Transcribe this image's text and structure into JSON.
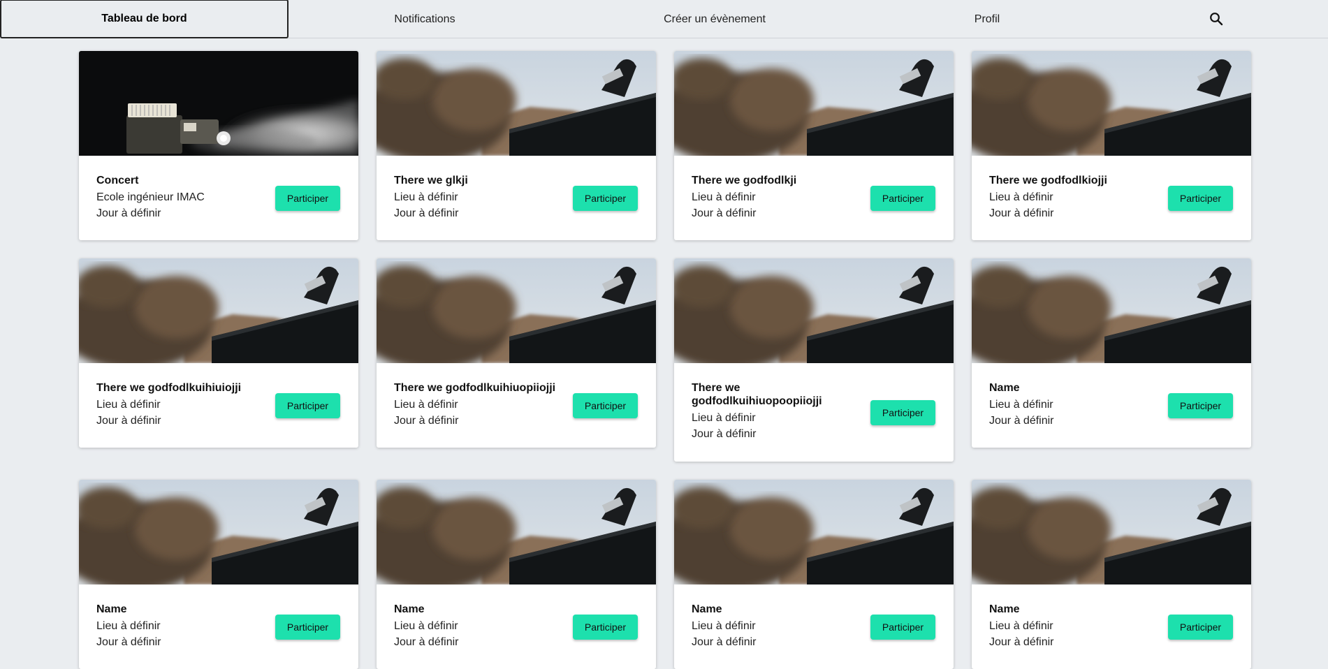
{
  "nav": {
    "items": [
      {
        "label": "Tableau de bord",
        "active": true
      },
      {
        "label": "Notifications",
        "active": false
      },
      {
        "label": "Créer un évènement",
        "active": false
      },
      {
        "label": "Profil",
        "active": false
      }
    ],
    "search_icon": "search-icon"
  },
  "colors": {
    "accent": "#1de0ad",
    "background": "#eaedf0"
  },
  "events": [
    {
      "title": "Concert",
      "place": "Ecole ingénieur IMAC",
      "day": "Jour à définir",
      "button": "Participer",
      "image": "projector-photo"
    },
    {
      "title": "There we glkji",
      "place": "Lieu à définir",
      "day": "Jour à définir",
      "button": "Participer",
      "image": "outdoor-photo"
    },
    {
      "title": "There we godfodlkji",
      "place": "Lieu à définir",
      "day": "Jour à définir",
      "button": "Participer",
      "image": "outdoor-photo"
    },
    {
      "title": "There we godfodlkiojji",
      "place": "Lieu à définir",
      "day": "Jour à définir",
      "button": "Participer",
      "image": "outdoor-photo"
    },
    {
      "title": "There we godfodlkuihiuiojji",
      "place": "Lieu à définir",
      "day": "Jour à définir",
      "button": "Participer",
      "image": "outdoor-photo"
    },
    {
      "title": "There we godfodlkuihiuopiiojji",
      "place": "Lieu à définir",
      "day": "Jour à définir",
      "button": "Participer",
      "image": "outdoor-photo"
    },
    {
      "title": "There we godfodlkuihiuopoopiiojji",
      "place": "Lieu à définir",
      "day": "Jour à définir",
      "button": "Participer",
      "image": "outdoor-photo"
    },
    {
      "title": "Name",
      "place": "Lieu à définir",
      "day": "Jour à définir",
      "button": "Participer",
      "image": "outdoor-photo"
    },
    {
      "title": "Name",
      "place": "Lieu à définir",
      "day": "Jour à définir",
      "button": "Participer",
      "image": "outdoor-photo"
    },
    {
      "title": "Name",
      "place": "Lieu à définir",
      "day": "Jour à définir",
      "button": "Participer",
      "image": "outdoor-photo"
    },
    {
      "title": "Name",
      "place": "Lieu à définir",
      "day": "Jour à définir",
      "button": "Participer",
      "image": "outdoor-photo"
    },
    {
      "title": "Name",
      "place": "Lieu à définir",
      "day": "Jour à définir",
      "button": "Participer",
      "image": "outdoor-photo"
    }
  ]
}
